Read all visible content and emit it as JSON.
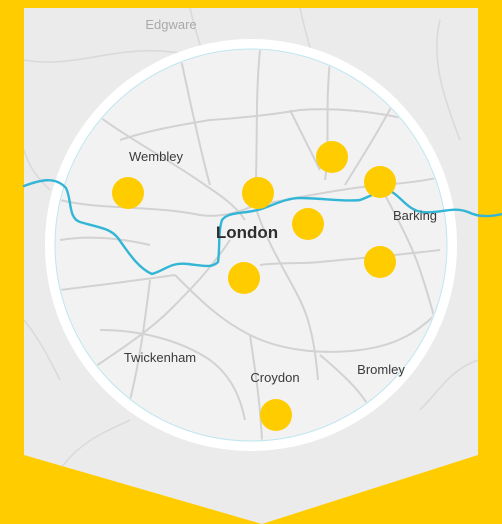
{
  "map": {
    "labels": {
      "edgware": "Edgware",
      "wembley": "Wembley",
      "london": "London",
      "barking": "Barking",
      "twickenham": "Twickenham",
      "croydon": "Croydon",
      "bromley": "Bromley"
    },
    "colors": {
      "frame": "#FFCC00",
      "map_bg": "#EBEBEB",
      "circle_bg": "#F2F2F2",
      "roads": "#D2D2D2",
      "river": "#33B5D6",
      "marker": "#FFCC00"
    },
    "marker_icon": "location-dot"
  }
}
